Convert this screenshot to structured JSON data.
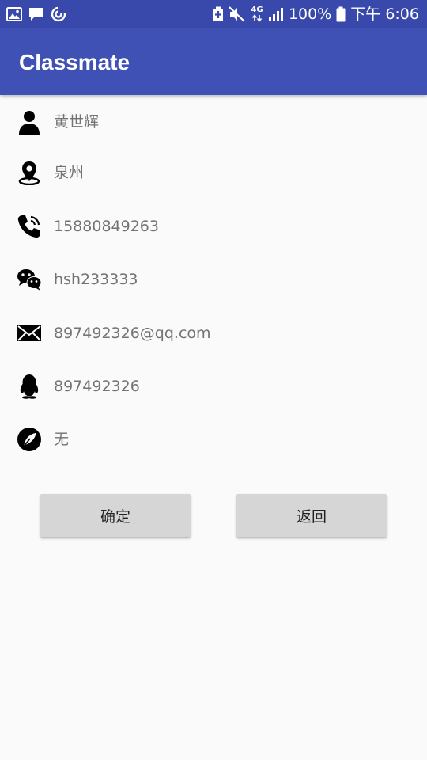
{
  "status_bar": {
    "network": "4G",
    "battery": "100%",
    "time": "下午 6:06"
  },
  "app_bar": {
    "title": "Classmate"
  },
  "contact": {
    "name": "黄世辉",
    "location": "泉州",
    "phone": "15880849263",
    "wechat": "hsh233333",
    "email": "897492326@qq.com",
    "qq": "897492326",
    "weibo": "无"
  },
  "actions": {
    "confirm_label": "确定",
    "back_label": "返回"
  },
  "colors": {
    "status_bar": "#3949ab",
    "app_bar": "#3f51b5",
    "background": "#fafafa",
    "value_text": "#737373",
    "button": "#d6d6d6"
  }
}
